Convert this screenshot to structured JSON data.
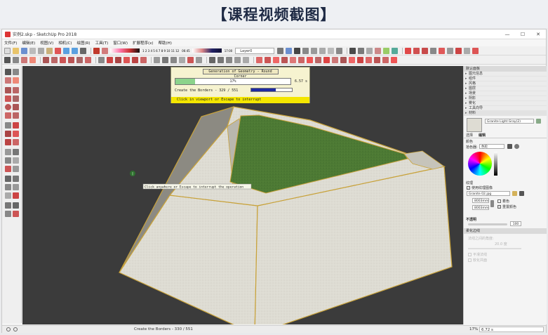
{
  "banner": {
    "title": "【课程视频截图】"
  },
  "window": {
    "title": "实例2.skp - SketchUp Pro 2018",
    "controls": [
      "—",
      "☐",
      "✕"
    ]
  },
  "menu": [
    "文件(F)",
    "编辑(E)",
    "视图(V)",
    "相机(C)",
    "绘图(R)",
    "工具(T)",
    "窗口(W)",
    "扩展程序(x)",
    "帮助(H)"
  ],
  "toolbar": {
    "layer_value": "Layer0",
    "scale_left": "1 2 3 4 5 6 7 8 9 10 11 12",
    "scale_mid": "06:45",
    "scale_right": "17:00"
  },
  "dialog": {
    "title": "Generation of Geometry - Round Corner",
    "progress_main_text": "17%",
    "progress_main_fraction": 0.17,
    "time": "6.57 s",
    "borders_label": "Create the Borders - 329 / 551",
    "borders_fraction": 0.6,
    "escape_hint": "Click in viewport or Escape to interrupt"
  },
  "viewport": {
    "tooltip": "Click anywhere or Escape to interrupt the operation",
    "cursor_glyph": "I"
  },
  "tray": {
    "header": "默认面板",
    "panels": [
      "图元信息",
      "组件",
      "风格",
      "图层",
      "场景",
      "阴影",
      "雾化",
      "工具向导",
      "材料"
    ],
    "material_name": "Granite Light Gray(2)",
    "tabs": {
      "select": "选择",
      "edit": "编辑"
    },
    "color_label": "颜色",
    "picker_label": "拾色器:",
    "picker_value": "色轮",
    "texture_label": "纹理",
    "use_texture": "使用纹理图像",
    "texture_file": "Granite 02.jpg",
    "width": "8003mm",
    "height": "8003mm",
    "reset_color": "着色",
    "colorize": "重置颜色",
    "opacity_label": "不透明",
    "opacity_value": "100",
    "softening_header": "柔化边线",
    "normal_angle": "法线之间的角度:",
    "angle_value": "20.0 度",
    "smooth_normals": "平滑法线",
    "soften_coplanar": "软化共面"
  },
  "status": {
    "left_text": "Create the Borders - 330 / 551",
    "zoom": "17%",
    "time": "6.72 s"
  },
  "colors": {
    "viewport_bg": "#3b3b3b",
    "granite": "#dedcd3",
    "grass": "#4d7a34",
    "edge": "#c8a23a",
    "dialog_bg": "#f6f3d0",
    "escape_yellow": "#f4e600"
  }
}
